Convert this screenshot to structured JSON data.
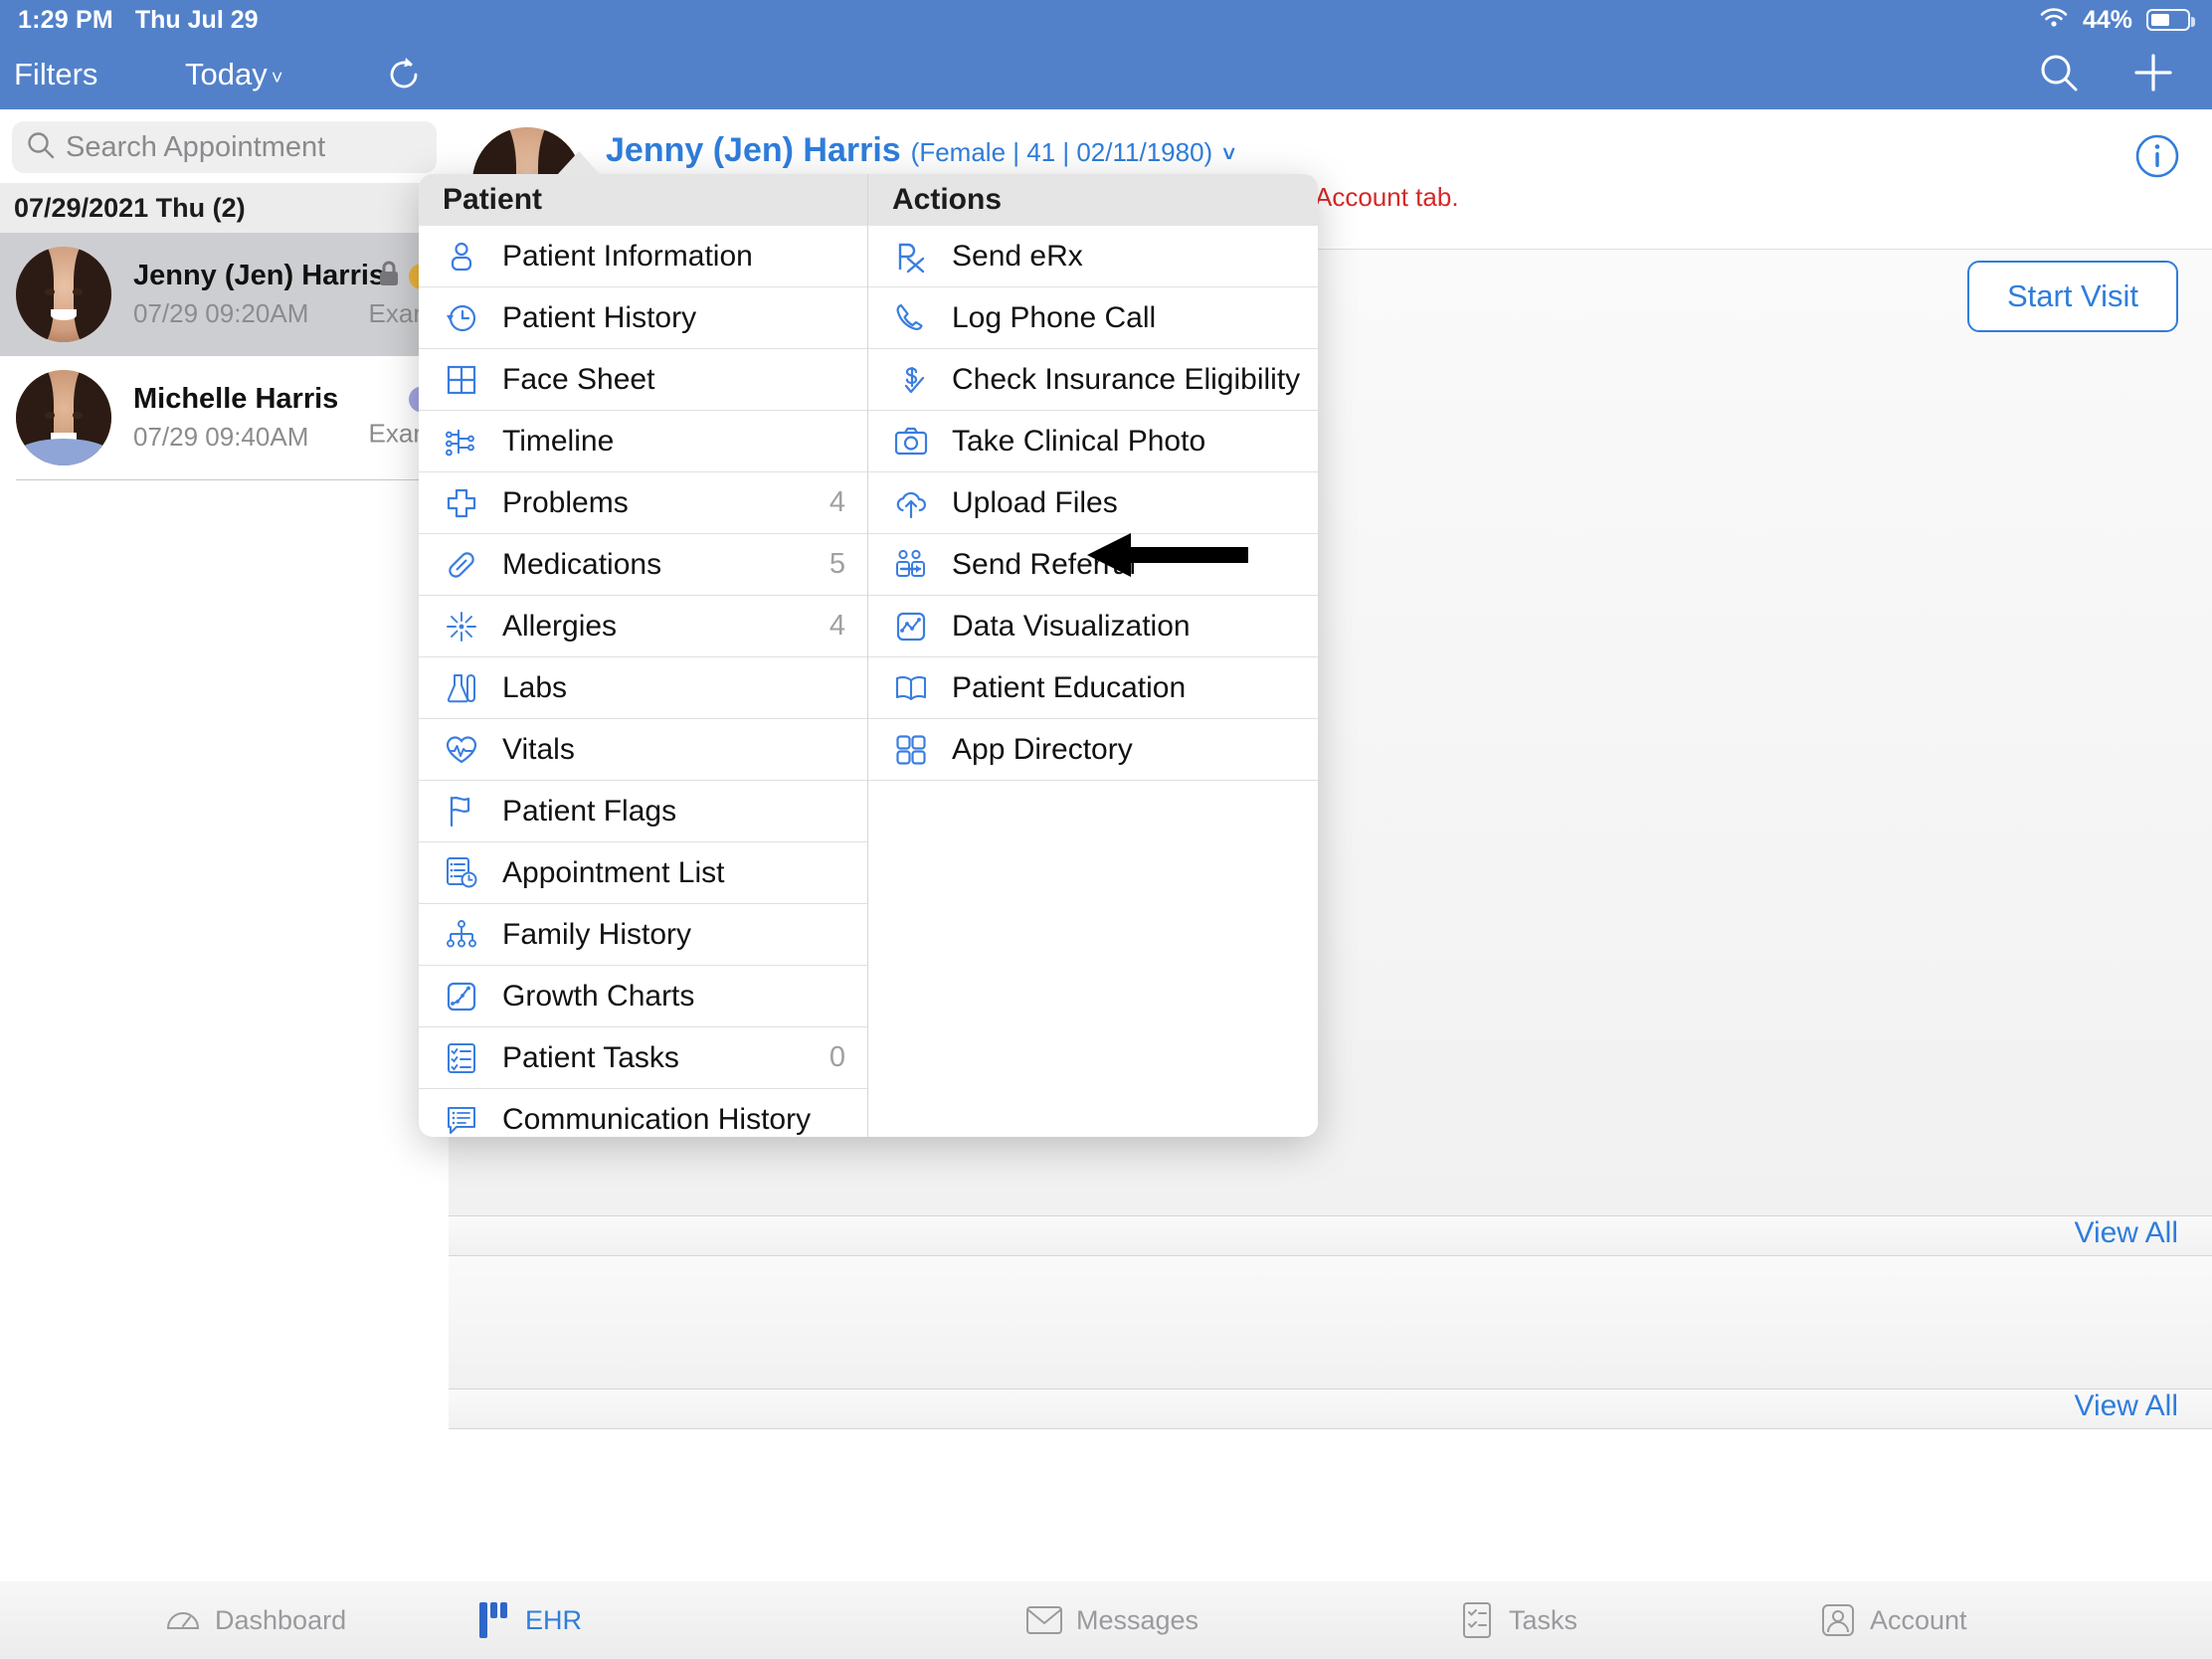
{
  "status_bar": {
    "time": "1:29 PM",
    "date": "Thu Jul 29",
    "battery_percent": "44%",
    "wifi_icon": "wifi-icon",
    "battery_icon": "battery-icon"
  },
  "sidebar": {
    "nav": {
      "filters_label": "Filters",
      "today_label": "Today",
      "chevron_icon": "chevron-down-icon",
      "refresh_icon": "refresh-icon"
    },
    "search": {
      "placeholder": "Search Appointment",
      "value": "",
      "icon": "search-icon"
    },
    "day_header": "07/29/2021 Thu (2)",
    "appointments": [
      {
        "name": "Jenny (Jen) Harris",
        "time": "07/29 09:20AM",
        "type": "Exam",
        "lock_icon": "lock-icon",
        "dot_color": "#e8b23a",
        "selected": true
      },
      {
        "name": "Michelle Harris",
        "time": "07/29 09:40AM",
        "type": "Exam",
        "lock_icon": "",
        "dot_color": "#a3a5e0",
        "selected": false
      }
    ]
  },
  "main": {
    "nav": {
      "search_icon": "search-icon",
      "add_icon": "plus-icon"
    },
    "patient": {
      "name": "Jenny (Jen) Harris",
      "demographics": "(Female | 41 | 02/11/1980)",
      "chevron_icon": "chevron-down-icon",
      "sample_warning": "This is a sample patient. To turn off sample patients, go to the Account tab.",
      "info_icon": "info-circle-icon",
      "start_visit_label": "Start Visit",
      "avatar": "patient-avatar"
    },
    "view_all_label_1": "View All",
    "view_all_label_2": "View All"
  },
  "popover": {
    "left": {
      "title": "Patient",
      "items": [
        {
          "label": "Patient Information",
          "count": "",
          "icon": "person-icon"
        },
        {
          "label": "Patient History",
          "count": "",
          "icon": "clock-history-icon"
        },
        {
          "label": "Face Sheet",
          "count": "",
          "icon": "grid-square-icon"
        },
        {
          "label": "Timeline",
          "count": "",
          "icon": "timeline-icon"
        },
        {
          "label": "Problems",
          "count": "4",
          "icon": "medical-cross-icon"
        },
        {
          "label": "Medications",
          "count": "5",
          "icon": "pill-icon"
        },
        {
          "label": "Allergies",
          "count": "4",
          "icon": "allergy-burst-icon"
        },
        {
          "label": "Labs",
          "count": "",
          "icon": "lab-flask-icon"
        },
        {
          "label": "Vitals",
          "count": "",
          "icon": "heart-pulse-icon"
        },
        {
          "label": "Patient Flags",
          "count": "",
          "icon": "flag-icon"
        },
        {
          "label": "Appointment List",
          "count": "",
          "icon": "appointment-list-icon"
        },
        {
          "label": "Family History",
          "count": "",
          "icon": "family-tree-icon"
        },
        {
          "label": "Growth Charts",
          "count": "",
          "icon": "growth-chart-icon"
        },
        {
          "label": "Patient Tasks",
          "count": "0",
          "icon": "checklist-icon"
        },
        {
          "label": "Communication History",
          "count": "",
          "icon": "chat-list-icon"
        }
      ]
    },
    "right": {
      "title": "Actions",
      "items": [
        {
          "label": "Send eRx",
          "count": "",
          "icon": "rx-icon"
        },
        {
          "label": "Log Phone Call",
          "count": "",
          "icon": "phone-icon"
        },
        {
          "label": "Check Insurance Eligibility",
          "count": "",
          "icon": "dollar-check-icon"
        },
        {
          "label": "Take Clinical Photo",
          "count": "",
          "icon": "camera-icon"
        },
        {
          "label": "Upload Files",
          "count": "",
          "icon": "cloud-upload-icon"
        },
        {
          "label": "Send Referral",
          "count": "",
          "icon": "referral-people-icon"
        },
        {
          "label": "Data Visualization",
          "count": "",
          "icon": "line-chart-icon"
        },
        {
          "label": "Patient Education",
          "count": "",
          "icon": "open-book-icon"
        },
        {
          "label": "App Directory",
          "count": "",
          "icon": "app-grid-icon"
        }
      ]
    },
    "annotation": {
      "pointer_icon": "annotation-arrow-left",
      "points_at": "Send Referral"
    }
  },
  "tabbar": {
    "tabs": [
      {
        "label": "Dashboard",
        "icon": "speedometer-icon",
        "active": false
      },
      {
        "label": "EHR",
        "icon": "ehr-icon",
        "active": true
      },
      {
        "label": "Messages",
        "icon": "messages-icon",
        "active": false
      },
      {
        "label": "Tasks",
        "icon": "tasks-icon",
        "active": false
      },
      {
        "label": "Account",
        "icon": "account-icon",
        "active": false
      }
    ]
  },
  "colors": {
    "accent_blue": "#2f7ddb",
    "nav_blue": "#5281ca",
    "warning_red": "#d62828"
  }
}
